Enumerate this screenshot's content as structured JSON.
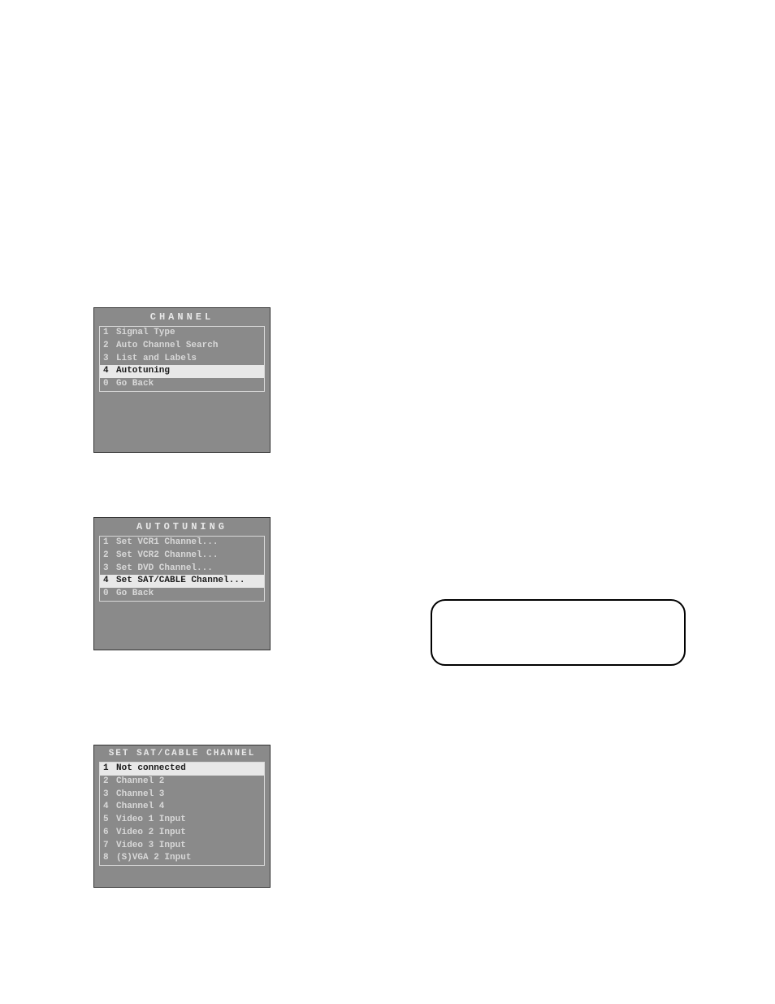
{
  "menus": {
    "channel": {
      "title": "CHANNEL",
      "items": [
        {
          "num": "1",
          "label": "Signal Type"
        },
        {
          "num": "2",
          "label": "Auto Channel Search"
        },
        {
          "num": "3",
          "label": "List and Labels"
        },
        {
          "num": "4",
          "label": "Autotuning"
        },
        {
          "num": "0",
          "label": "Go Back"
        }
      ]
    },
    "autotuning": {
      "title": "AUTOTUNING",
      "items": [
        {
          "num": "1",
          "label": "Set VCR1 Channel..."
        },
        {
          "num": "2",
          "label": "Set VCR2 Channel..."
        },
        {
          "num": "3",
          "label": "Set DVD Channel..."
        },
        {
          "num": "4",
          "label": "Set SAT/CABLE Channel..."
        },
        {
          "num": "0",
          "label": "Go Back"
        }
      ]
    },
    "set_sat_cable": {
      "title": "SET SAT/CABLE CHANNEL",
      "items": [
        {
          "num": "1",
          "label": "Not connected"
        },
        {
          "num": "2",
          "label": "Channel 2"
        },
        {
          "num": "3",
          "label": "Channel 3"
        },
        {
          "num": "4",
          "label": "Channel 4"
        },
        {
          "num": "5",
          "label": "Video 1 Input"
        },
        {
          "num": "6",
          "label": "Video 2 Input"
        },
        {
          "num": "7",
          "label": "Video 3 Input"
        },
        {
          "num": "8",
          "label": "(S)VGA 2 Input"
        }
      ]
    }
  }
}
